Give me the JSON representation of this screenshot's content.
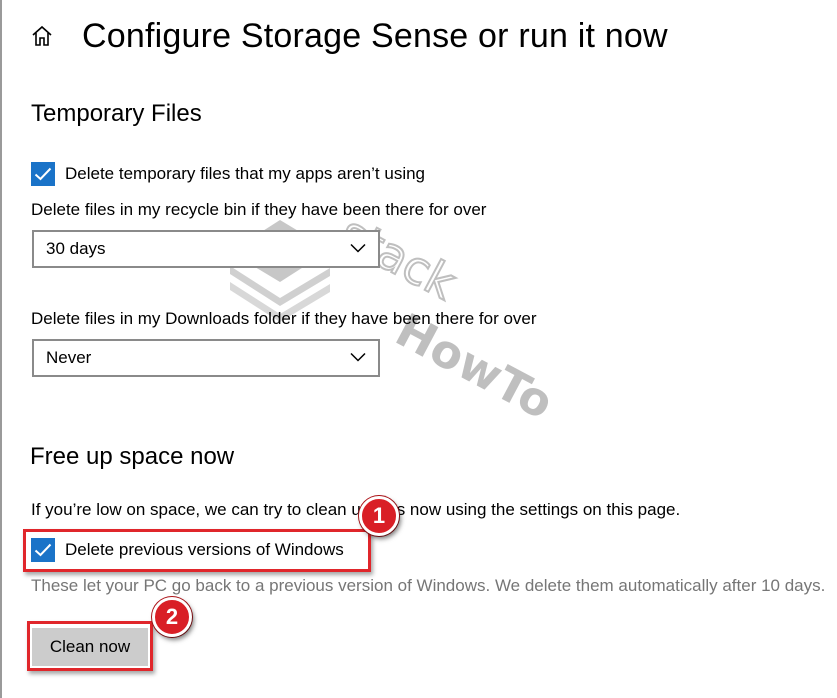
{
  "header": {
    "title": "Configure Storage Sense or run it now",
    "home_icon": "home-icon"
  },
  "temporary_files": {
    "title": "Temporary Files",
    "delete_temp_checkbox": {
      "label": "Delete temporary files that my apps aren’t using",
      "checked": true
    },
    "recycle_bin": {
      "label": "Delete files in my recycle bin if they have been there for over",
      "selected": "30 days"
    },
    "downloads": {
      "label": "Delete files in my Downloads folder if they have been there for over",
      "selected": "Never"
    }
  },
  "free_up": {
    "title": "Free up space now",
    "description": "If you’re low on space, we can try to clean up files now using the settings on this page.",
    "previous_windows_checkbox": {
      "label": "Delete previous versions of Windows",
      "checked": true
    },
    "hint": "These let your PC go back to a previous version of Windows. We delete them automatically after 10 days.",
    "clean_button": "Clean now"
  },
  "annotations": {
    "marker_1": "1",
    "marker_2": "2"
  },
  "watermark": {
    "word_1": "stack",
    "word_2": "HowTo"
  },
  "colors": {
    "accent": "#1a73c8",
    "highlight": "#e0262b",
    "hint_text": "#767676",
    "button_bg": "#cccccc"
  }
}
